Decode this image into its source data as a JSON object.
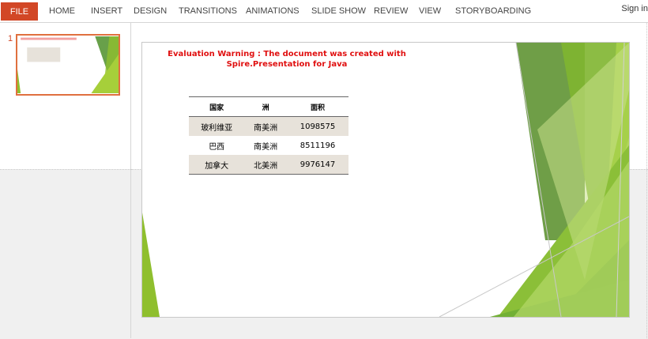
{
  "ribbon": {
    "file_label": "FILE",
    "tabs": [
      "HOME",
      "INSERT",
      "DESIGN",
      "TRANSITIONS",
      "ANIMATIONS",
      "SLIDE SHOW",
      "REVIEW",
      "VIEW",
      "STORYBOARDING"
    ],
    "signin_label": "Sign in"
  },
  "thumbnails": {
    "slide_number": "1"
  },
  "slide": {
    "warning_text": "Evaluation Warning : The document was created with  Spire.Presentation for Java",
    "table": {
      "headers": [
        "国家",
        "洲",
        "面积"
      ],
      "rows": [
        [
          "玻利维亚",
          "南美洲",
          "1098575"
        ],
        [
          "巴西",
          "南美洲",
          "8511196"
        ],
        [
          "加拿大",
          "北美洲",
          "9976147"
        ]
      ]
    }
  },
  "colors": {
    "accent": "#d24726",
    "thumb_border": "#e0703f",
    "warning_text": "#e01010",
    "green_dark": "#4e8f2a",
    "green_light": "#a6cf3a"
  }
}
